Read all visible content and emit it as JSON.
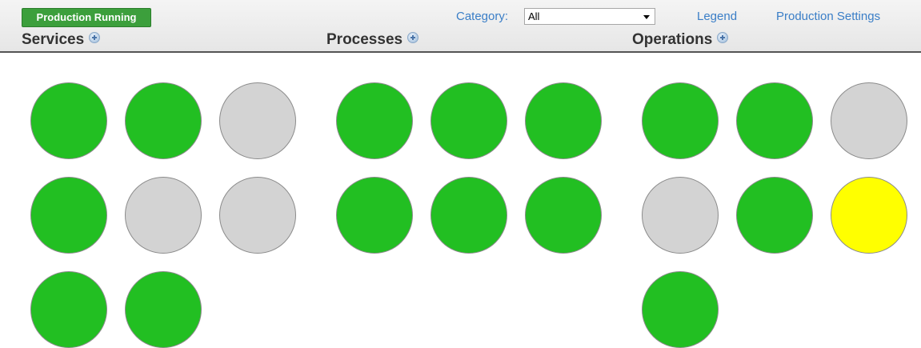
{
  "header": {
    "status_button": "Production Running",
    "category_label": "Category:",
    "category_value": "All",
    "legend_link": "Legend",
    "settings_link": "Production Settings"
  },
  "colors": {
    "running": "#22bf22",
    "disabled": "#d3d3d3",
    "warning": "#ffff00"
  },
  "columns": [
    {
      "title": "Services",
      "items": [
        "running",
        "running",
        "disabled",
        "running",
        "disabled",
        "disabled",
        "running",
        "running"
      ]
    },
    {
      "title": "Processes",
      "items": [
        "running",
        "running",
        "running",
        "running",
        "running",
        "running"
      ]
    },
    {
      "title": "Operations",
      "items": [
        "running",
        "running",
        "disabled",
        "disabled",
        "running",
        "warning",
        "running"
      ]
    }
  ]
}
